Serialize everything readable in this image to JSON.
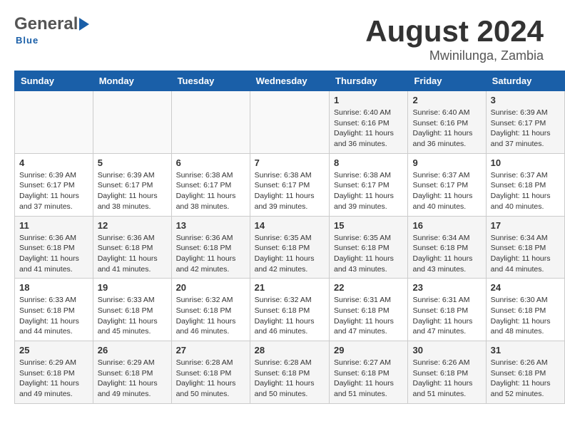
{
  "header": {
    "logo": {
      "general": "General",
      "blue": "Blue"
    },
    "title": "August 2024",
    "location": "Mwinilunga, Zambia"
  },
  "calendar": {
    "days_of_week": [
      "Sunday",
      "Monday",
      "Tuesday",
      "Wednesday",
      "Thursday",
      "Friday",
      "Saturday"
    ],
    "weeks": [
      {
        "cells": [
          {
            "day": "",
            "info": ""
          },
          {
            "day": "",
            "info": ""
          },
          {
            "day": "",
            "info": ""
          },
          {
            "day": "",
            "info": ""
          },
          {
            "day": "1",
            "info": "Sunrise: 6:40 AM\nSunset: 6:16 PM\nDaylight: 11 hours\nand 36 minutes."
          },
          {
            "day": "2",
            "info": "Sunrise: 6:40 AM\nSunset: 6:16 PM\nDaylight: 11 hours\nand 36 minutes."
          },
          {
            "day": "3",
            "info": "Sunrise: 6:39 AM\nSunset: 6:17 PM\nDaylight: 11 hours\nand 37 minutes."
          }
        ]
      },
      {
        "cells": [
          {
            "day": "4",
            "info": "Sunrise: 6:39 AM\nSunset: 6:17 PM\nDaylight: 11 hours\nand 37 minutes."
          },
          {
            "day": "5",
            "info": "Sunrise: 6:39 AM\nSunset: 6:17 PM\nDaylight: 11 hours\nand 38 minutes."
          },
          {
            "day": "6",
            "info": "Sunrise: 6:38 AM\nSunset: 6:17 PM\nDaylight: 11 hours\nand 38 minutes."
          },
          {
            "day": "7",
            "info": "Sunrise: 6:38 AM\nSunset: 6:17 PM\nDaylight: 11 hours\nand 39 minutes."
          },
          {
            "day": "8",
            "info": "Sunrise: 6:38 AM\nSunset: 6:17 PM\nDaylight: 11 hours\nand 39 minutes."
          },
          {
            "day": "9",
            "info": "Sunrise: 6:37 AM\nSunset: 6:17 PM\nDaylight: 11 hours\nand 40 minutes."
          },
          {
            "day": "10",
            "info": "Sunrise: 6:37 AM\nSunset: 6:18 PM\nDaylight: 11 hours\nand 40 minutes."
          }
        ]
      },
      {
        "cells": [
          {
            "day": "11",
            "info": "Sunrise: 6:36 AM\nSunset: 6:18 PM\nDaylight: 11 hours\nand 41 minutes."
          },
          {
            "day": "12",
            "info": "Sunrise: 6:36 AM\nSunset: 6:18 PM\nDaylight: 11 hours\nand 41 minutes."
          },
          {
            "day": "13",
            "info": "Sunrise: 6:36 AM\nSunset: 6:18 PM\nDaylight: 11 hours\nand 42 minutes."
          },
          {
            "day": "14",
            "info": "Sunrise: 6:35 AM\nSunset: 6:18 PM\nDaylight: 11 hours\nand 42 minutes."
          },
          {
            "day": "15",
            "info": "Sunrise: 6:35 AM\nSunset: 6:18 PM\nDaylight: 11 hours\nand 43 minutes."
          },
          {
            "day": "16",
            "info": "Sunrise: 6:34 AM\nSunset: 6:18 PM\nDaylight: 11 hours\nand 43 minutes."
          },
          {
            "day": "17",
            "info": "Sunrise: 6:34 AM\nSunset: 6:18 PM\nDaylight: 11 hours\nand 44 minutes."
          }
        ]
      },
      {
        "cells": [
          {
            "day": "18",
            "info": "Sunrise: 6:33 AM\nSunset: 6:18 PM\nDaylight: 11 hours\nand 44 minutes."
          },
          {
            "day": "19",
            "info": "Sunrise: 6:33 AM\nSunset: 6:18 PM\nDaylight: 11 hours\nand 45 minutes."
          },
          {
            "day": "20",
            "info": "Sunrise: 6:32 AM\nSunset: 6:18 PM\nDaylight: 11 hours\nand 46 minutes."
          },
          {
            "day": "21",
            "info": "Sunrise: 6:32 AM\nSunset: 6:18 PM\nDaylight: 11 hours\nand 46 minutes."
          },
          {
            "day": "22",
            "info": "Sunrise: 6:31 AM\nSunset: 6:18 PM\nDaylight: 11 hours\nand 47 minutes."
          },
          {
            "day": "23",
            "info": "Sunrise: 6:31 AM\nSunset: 6:18 PM\nDaylight: 11 hours\nand 47 minutes."
          },
          {
            "day": "24",
            "info": "Sunrise: 6:30 AM\nSunset: 6:18 PM\nDaylight: 11 hours\nand 48 minutes."
          }
        ]
      },
      {
        "cells": [
          {
            "day": "25",
            "info": "Sunrise: 6:29 AM\nSunset: 6:18 PM\nDaylight: 11 hours\nand 49 minutes."
          },
          {
            "day": "26",
            "info": "Sunrise: 6:29 AM\nSunset: 6:18 PM\nDaylight: 11 hours\nand 49 minutes."
          },
          {
            "day": "27",
            "info": "Sunrise: 6:28 AM\nSunset: 6:18 PM\nDaylight: 11 hours\nand 50 minutes."
          },
          {
            "day": "28",
            "info": "Sunrise: 6:28 AM\nSunset: 6:18 PM\nDaylight: 11 hours\nand 50 minutes."
          },
          {
            "day": "29",
            "info": "Sunrise: 6:27 AM\nSunset: 6:18 PM\nDaylight: 11 hours\nand 51 minutes."
          },
          {
            "day": "30",
            "info": "Sunrise: 6:26 AM\nSunset: 6:18 PM\nDaylight: 11 hours\nand 51 minutes."
          },
          {
            "day": "31",
            "info": "Sunrise: 6:26 AM\nSunset: 6:18 PM\nDaylight: 11 hours\nand 52 minutes."
          }
        ]
      }
    ]
  }
}
